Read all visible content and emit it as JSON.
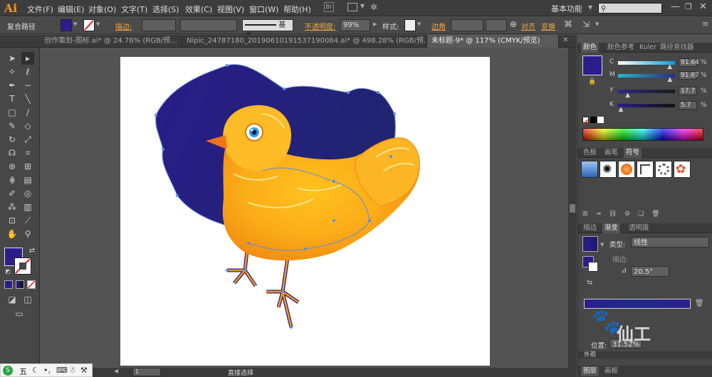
{
  "app": {
    "logo": "Ai"
  },
  "menu": [
    "文件(F)",
    "编辑(E)",
    "对象(O)",
    "文字(T)",
    "选择(S)",
    "效果(C)",
    "视图(V)",
    "窗口(W)",
    "帮助(H)"
  ],
  "workspace": {
    "label": "基本功能"
  },
  "search": {
    "placeholder": ""
  },
  "control_bar": {
    "object_type": "复合路径",
    "stroke_label": "描边:",
    "stroke_profile": "基本",
    "opacity_label": "不透明度:",
    "opacity_value": "99%",
    "style_label": "样式:",
    "edge_label": "边角",
    "align_label": "对齐",
    "transform_label": "变换",
    "fill_color": "#2b1e8c"
  },
  "doc_tabs": [
    {
      "label": "创作策划-图标.ai* @ 24.76% (RGB/预...",
      "active": false
    },
    {
      "label": "Nipic_24787180_20190610191537190084.ai* @ 498.28% (RGB/预...",
      "active": false
    },
    {
      "label": "未标题-9* @ 117% (CMYK/预览)",
      "active": true
    }
  ],
  "status": {
    "zoom_page": "1",
    "tool_status": "直接选择"
  },
  "color_panel": {
    "tabs": [
      "颜色",
      "颜色参考",
      "Kuler",
      "路径查找器"
    ],
    "channels": [
      {
        "name": "C",
        "value": "91.64",
        "fraction": 0.9164
      },
      {
        "name": "M",
        "value": "91.67",
        "fraction": 0.9167
      },
      {
        "name": "Y",
        "value": "17.7",
        "fraction": 0.177
      },
      {
        "name": "K",
        "value": "5.7",
        "fraction": 0.057
      }
    ],
    "unit": "%",
    "fill": "#2b1e8c"
  },
  "swatch_panel": {
    "tabs": [
      "色板",
      "画笔",
      "符号"
    ]
  },
  "gradient_panel": {
    "tabs": [
      "描边",
      "渐变",
      "透明度"
    ],
    "type_label": "类型:",
    "type_value": "线性",
    "stroke_label": "描边:",
    "angle_value": "20.5°",
    "location_label": "位置:",
    "location_value": "31.52%",
    "colors": [
      "#2b1e8c",
      "#1e2a8a"
    ]
  },
  "bottom_tabs": {
    "appearance": "外观",
    "layers": "图层",
    "artboards": "画板"
  },
  "watermark": {
    "text": "仙工"
  },
  "ime": {
    "label": "五"
  }
}
